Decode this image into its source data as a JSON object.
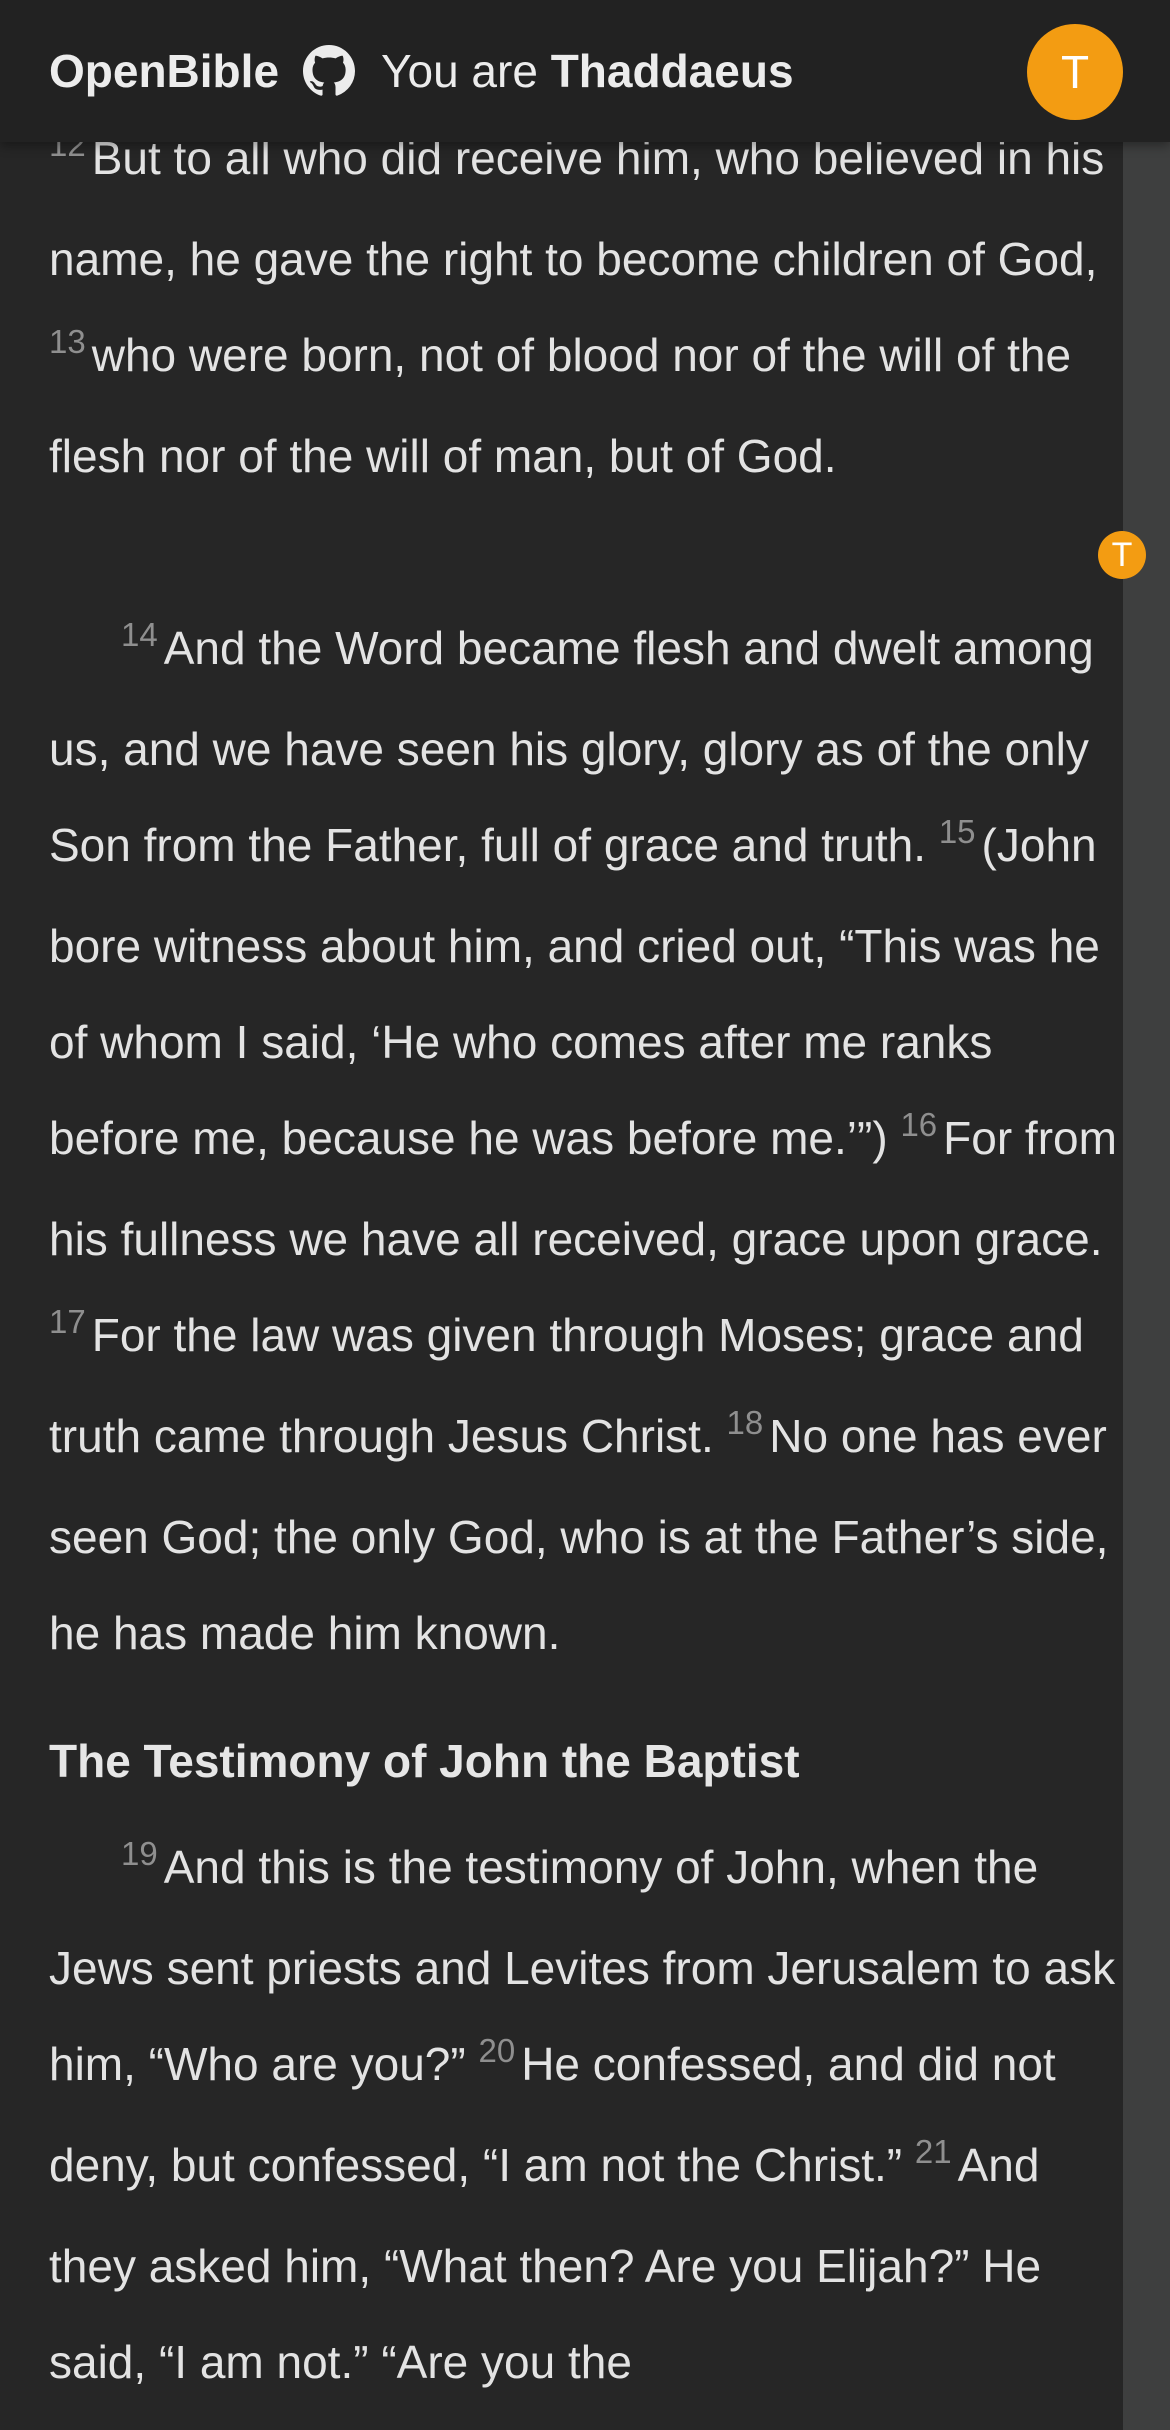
{
  "header": {
    "brand": "OpenBible",
    "github_icon": "github-icon",
    "you_are_prefix": "You are",
    "user_name": "Thaddaeus",
    "avatar_letter": "T",
    "avatar_color": "#f39c12"
  },
  "scroll_marker": {
    "letter": "T"
  },
  "passage": {
    "para1": [
      {
        "num": "12",
        "text": "But to all who did receive him, who believed in his name, he gave the right to become children of God,"
      },
      {
        "num": "13",
        "text": "who were born, not of blood nor of the will of the flesh nor of the will of man, but of God."
      }
    ],
    "para2": [
      {
        "num": "14",
        "text": "And the Word became flesh and dwelt among us, and we have seen his glory, glory as of the only Son from the Father, full of grace and truth."
      },
      {
        "num": "15",
        "text": "(John bore witness about him, and cried out, “This was he of whom I said, ‘He who comes after me ranks before me, because he was before me.’”)"
      },
      {
        "num": "16",
        "text": "For from his fullness we have all received, grace upon grace."
      },
      {
        "num": "17",
        "text": "For the law was given through Moses; grace and truth came through Jesus Christ."
      },
      {
        "num": "18",
        "text": "No one has ever seen God; the only God, who is at the Father’s side, he has made him known."
      }
    ],
    "heading": "The Testimony of John the Baptist",
    "para3": [
      {
        "num": "19",
        "text": "And this is the testimony of John, when the Jews sent priests and Levites from Jerusalem to ask him, “Who are you?”"
      },
      {
        "num": "20",
        "text": "He confessed, and did not deny, but confessed, “I am not the Christ.”"
      },
      {
        "num": "21",
        "text": "And they asked him, “What then? Are you Elijah?” He said, “I am not.” “Are you the"
      }
    ]
  }
}
